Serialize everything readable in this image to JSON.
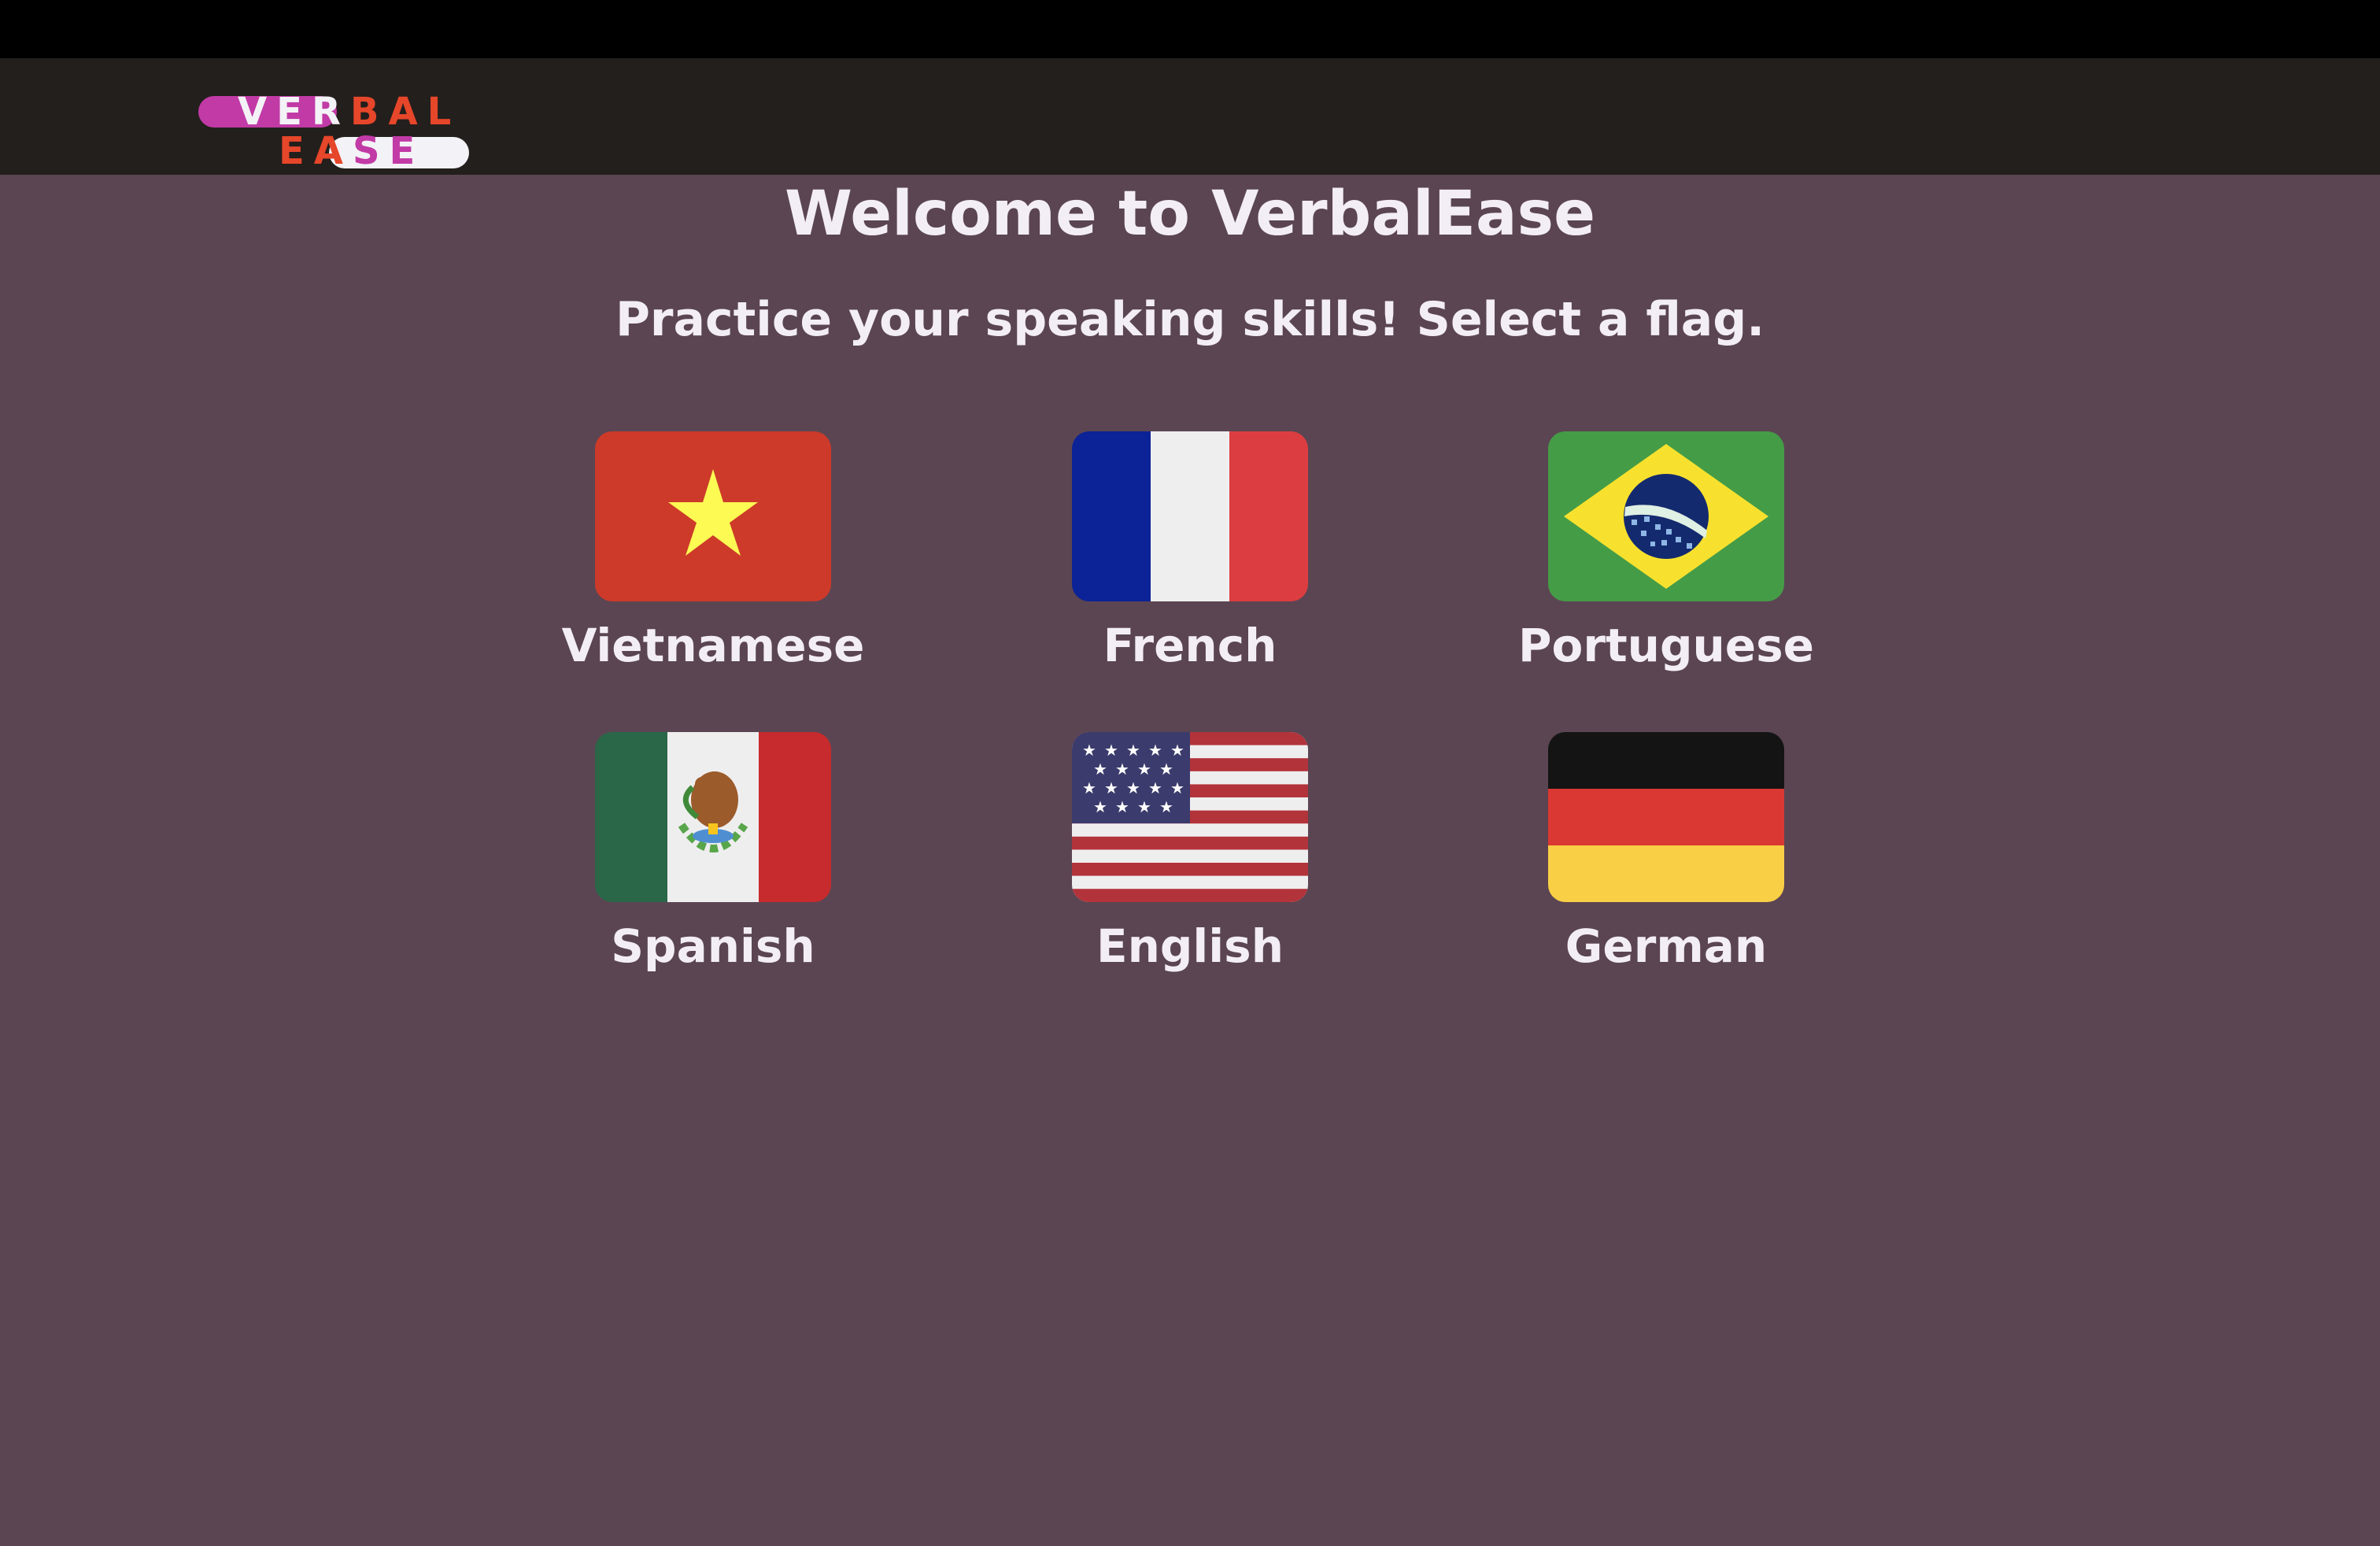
{
  "app": {
    "logo": {
      "row1": [
        "V",
        "E",
        "R",
        "B",
        "A",
        "L"
      ],
      "row2": [
        "E",
        "A",
        "S",
        "E"
      ],
      "colors": {
        "pink": "#c13aa6",
        "white": "#f3f2f6",
        "red": "#e6462a"
      }
    }
  },
  "main": {
    "title": "Welcome to VerbalEase",
    "subtitle": "Practice your speaking skills! Select a flag."
  },
  "languages": [
    {
      "label": "Vietnamese",
      "flag": "vietnam-flag-icon"
    },
    {
      "label": "French",
      "flag": "france-flag-icon"
    },
    {
      "label": "Portuguese",
      "flag": "brazil-flag-icon"
    },
    {
      "label": "Spanish",
      "flag": "mexico-flag-icon"
    },
    {
      "label": "English",
      "flag": "usa-flag-icon"
    },
    {
      "label": "German",
      "flag": "germany-flag-icon"
    }
  ],
  "colors": {
    "background": "#5b4552",
    "navbar": "#231f1c",
    "topStrip": "#000000",
    "text": "#f3eef6"
  }
}
